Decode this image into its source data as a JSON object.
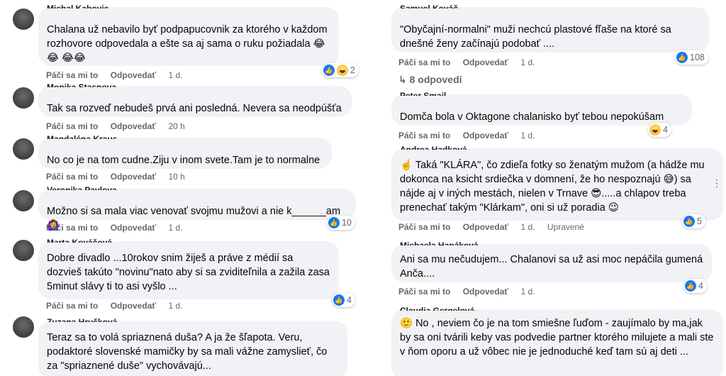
{
  "actions": {
    "like": "Páči sa mi to",
    "reply": "Odpovedať"
  },
  "left": [
    {
      "author": "Michal Kabovic",
      "text": "Chalana už nebavilo byť podpapucovnik za ktorého v každom rozhovore odpovedala a ešte sa aj sama o ruku požiadala 😂😂 😂😂",
      "time": "1 d.",
      "reactions": {
        "icons": [
          "like-icon",
          "haha-icon"
        ],
        "count": "2"
      }
    },
    {
      "author": "Monika Stasnova",
      "text": "Tak sa rozveď nebudeš prvá ani posledná. Nevera sa neodpúšťa",
      "time": "20 h"
    },
    {
      "author": "Magdaléna Kraus",
      "text": "No co je na tom cudne.Ziju v inom svete.Tam je to normalne",
      "time": "10 h"
    },
    {
      "author": "Veronika Pavlova",
      "text": "Možno si sa mala viac venovať svojmu mužovi a nie k______am 🙆‍♀️",
      "time": "1 d.",
      "reactions": {
        "icons": [
          "like-icon"
        ],
        "count": "10"
      }
    },
    {
      "author": "Marta Kováčová",
      "text": "Dobre divadlo ...10rokov snim žiješ a práve z médií sa dozvieš takúto \"novinu\"nato aby si sa zviditeľnila a zažila zasa 5minut slávy ti to asi vyšlo ...",
      "time": "1 d.",
      "reactions": {
        "icons": [
          "like-icon"
        ],
        "count": "4"
      }
    },
    {
      "author": "Zuzana Hrušková",
      "text": "Teraz sa to volá spriaznená duša? A ja že šľapota. Veru, podaktoré slovenské mamičky by sa mali vážne zamyslieť, čo za \"spriaznené duše\" vychovávajú..."
    }
  ],
  "right": [
    {
      "author": "Samuel Kováč",
      "text": "\"Obyčajní-normalni\" muži nechcú plastové fľaše na ktoré sa dnešné ženy začínajú podobať ....",
      "time": "1 d.",
      "reactions": {
        "icons": [
          "like-icon"
        ],
        "count": "108"
      },
      "replies": "8 odpovedí"
    },
    {
      "author": "Peter Smail",
      "text": "Domča bola v Oktagone chalanisko byť tebou nepokúšam",
      "time": "1 d.",
      "reactions": {
        "icons": [
          "haha-icon"
        ],
        "count": "4"
      }
    },
    {
      "author": "Andrea Hadková",
      "text": "☝️ Taká \"KLÁRA\", čo zdieľa fotky so ženatým mužom (a hádže mu dokonca na ksicht srdiečka v domnení, že ho nespoznajú 😅) sa nájde aj v iných mestách, nielen v Trnave 😎.....a chlapov treba prenechať takým \"Klárkam\", oni si už poradia 😉",
      "time": "1 d.",
      "edited": "Upravené",
      "reactions": {
        "icons": [
          "like-icon"
        ],
        "count": "5"
      }
    },
    {
      "author": "Michaela Hanáková",
      "text": "Ani sa mu nečudujem... Chalanovi sa už asi moc nepáčila gumená Anča....",
      "time": "1 d.",
      "reactions": {
        "icons": [
          "like-icon"
        ],
        "count": "4"
      }
    },
    {
      "author": "Claudia Gergelová",
      "text": "🙂 No , neviem čo je na tom smiešne ľuďom - zaujímalo by ma,jak by sa oni tvárili keby vas podvedie partner ktorého milujete a mali ste v ňom oporu a už vôbec nie je jednoduché keď tam sú aj deti ..."
    }
  ],
  "more": "⋮"
}
